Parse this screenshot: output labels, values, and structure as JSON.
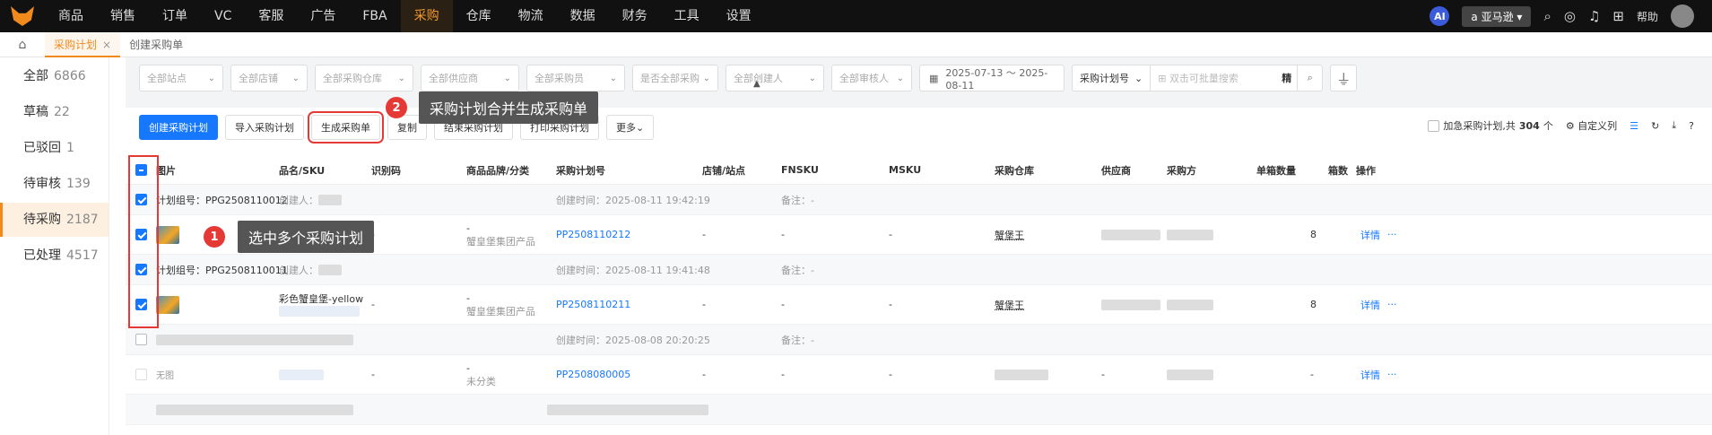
{
  "nav": {
    "items": [
      "商品",
      "销售",
      "订单",
      "VC",
      "客服",
      "广告",
      "FBA",
      "采购",
      "仓库",
      "物流",
      "数据",
      "财务",
      "工具",
      "设置"
    ],
    "active_index": 7,
    "ai": "AI",
    "store": "亚马逊",
    "help": "帮助"
  },
  "tabs": {
    "active_label": "采购计划",
    "second_label": "创建采购单",
    "close": "×"
  },
  "sidebar": {
    "items": [
      {
        "label": "全部",
        "count": "6866"
      },
      {
        "label": "草稿",
        "count": "22"
      },
      {
        "label": "已驳回",
        "count": "1"
      },
      {
        "label": "待审核",
        "count": "139"
      },
      {
        "label": "待采购",
        "count": "2187"
      },
      {
        "label": "已处理",
        "count": "4517"
      }
    ],
    "active_index": 4
  },
  "filters": {
    "selects": [
      "全部站点",
      "全部店铺",
      "全部采购仓库",
      "全部供应商",
      "全部采购员",
      "是否全部采购",
      "全部创建人",
      "全部审核人"
    ],
    "date_range": "2025-07-13 ～ 2025-08-11",
    "search_field": "采购计划号",
    "search_placeholder": "双击可批量搜索",
    "exact": "精"
  },
  "toolbar": {
    "buttons": [
      "创建采购计划",
      "导入采购计划",
      "生成采购单",
      "复制",
      "结束采购计划",
      "打印采购计划",
      "更多"
    ],
    "urgent_label": "加急采购计划,共",
    "total": "304",
    "unit": "个",
    "custom_cols": "自定义列"
  },
  "table": {
    "headers": [
      "图片",
      "品名/SKU",
      "识别码",
      "商品品牌/分类",
      "采购计划号",
      "店铺/站点",
      "FNSKU",
      "MSKU",
      "采购仓库",
      "供应商",
      "采购方",
      "单箱数量",
      "箱数",
      "操作"
    ],
    "groups": [
      {
        "group_no": "计划组号：PPG2508110012",
        "creator": "创建人：",
        "created": "创建时间：2025-08-11 19:42:19",
        "note": "备注：-"
      },
      {
        "group_no": "计划组号：PPG2508110011",
        "creator": "创建人：",
        "created": "创建时间：2025-08-11 19:41:48",
        "note": "备注：-"
      },
      {
        "group_no": "",
        "creator": "",
        "created": "创建时间：2025-08-08 20:20:25",
        "note": "备注：-"
      }
    ],
    "rows": [
      {
        "name": "彩色蟹堡堡-yellow",
        "ident": "-",
        "brand": "-",
        "category": "蟹皇堡集团产品",
        "plan_no": "PP2508110212",
        "shop": "-",
        "fnsku": "-",
        "msku": "-",
        "warehouse": "蟹堡王",
        "qty": "8",
        "action": "详情",
        "more": "···"
      },
      {
        "name": "彩色蟹皇堡-yellow",
        "ident": "-",
        "brand": "-",
        "category": "蟹皇堡集团产品",
        "plan_no": "PP2508110211",
        "shop": "-",
        "fnsku": "-",
        "msku": "-",
        "warehouse": "蟹堡王",
        "qty": "8",
        "action": "详情",
        "more": "···"
      },
      {
        "name": "",
        "ident": "-",
        "brand": "-",
        "category": "未分类",
        "plan_no": "PP2508080005",
        "shop": "-",
        "fnsku": "-",
        "msku": "-",
        "warehouse": "",
        "supplier": "-",
        "qty": "-",
        "action": "详情",
        "more": "···",
        "noimg": "无图"
      }
    ]
  },
  "annotations": [
    {
      "num": "1",
      "text": "选中多个采购计划"
    },
    {
      "num": "2",
      "text": "采购计划合并生成采购单"
    }
  ]
}
